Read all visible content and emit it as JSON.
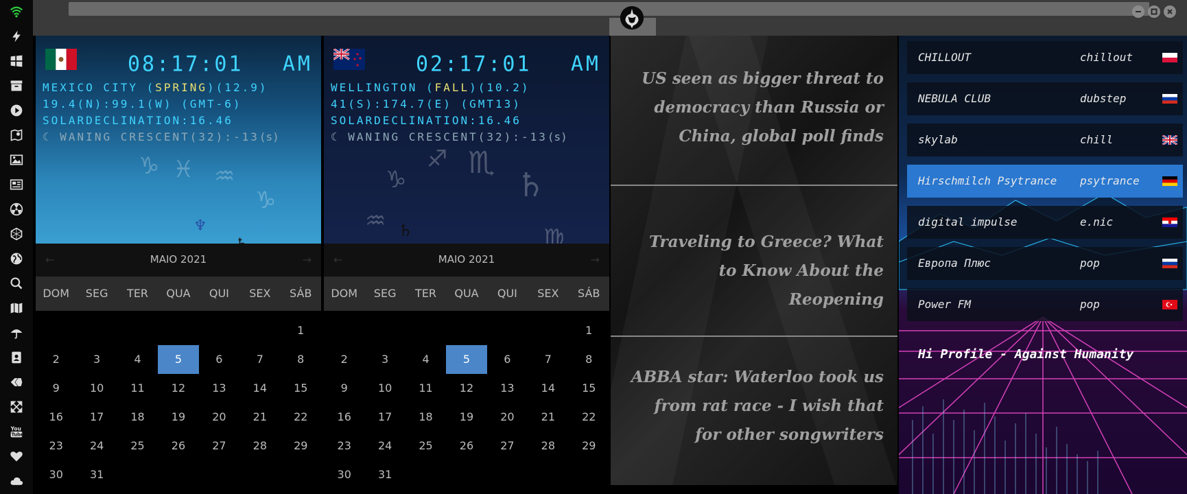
{
  "sidebar": {
    "icons": [
      "wifi-icon",
      "lightning-icon",
      "windows-icon",
      "archive-icon",
      "play-icon",
      "map-book-icon",
      "image-icon",
      "news-icon",
      "radiation-icon",
      "hexagon-icon",
      "globe-icon",
      "search-icon",
      "map-icon",
      "umbrella-icon",
      "contacts-icon",
      "tag-icon",
      "expand-icon",
      "youtube-icon",
      "heart-icon",
      "cloud-icon"
    ]
  },
  "clocks": [
    {
      "time": "08:17:01",
      "ampm": "AM",
      "city": "MEXICO CITY",
      "season": "SPRING",
      "temp": "(12.9)",
      "coords": "19.4(N):99.1(W) (GMT-6)",
      "declination": "SOLARDECLINATION:16.46",
      "moon": "WANING CRESCENT(32):-13",
      "moon_unit": "(s)"
    },
    {
      "time": "02:17:01",
      "ampm": "AM",
      "city": "WELLINGTON",
      "season": "FALL",
      "temp": "(10.2)",
      "coords": "41(S):174.7(E) (GMT13)",
      "declination": "SOLARDECLINATION:16.46",
      "moon": "WANING CRESCENT(32):-13",
      "moon_unit": "(s)"
    }
  ],
  "calendar": {
    "title": "MAIO 2021",
    "prev": "←",
    "next": "→",
    "weekdays": [
      "DOM",
      "SEG",
      "TER",
      "QUA",
      "QUI",
      "SEX",
      "SÁB"
    ],
    "selected": "5",
    "weeks": [
      [
        "",
        "",
        "",
        "",
        "",
        "",
        "1"
      ],
      [
        "2",
        "3",
        "4",
        "5",
        "6",
        "7",
        "8"
      ],
      [
        "9",
        "10",
        "11",
        "12",
        "13",
        "14",
        "15"
      ],
      [
        "16",
        "17",
        "18",
        "19",
        "20",
        "21",
        "22"
      ],
      [
        "23",
        "24",
        "25",
        "26",
        "27",
        "28",
        "29"
      ],
      [
        "30",
        "31",
        "",
        "",
        "",
        "",
        ""
      ]
    ]
  },
  "news": [
    "US seen as bigger threat to democracy than Russia or China, global poll finds",
    "Traveling to Greece? What to Know About the Reopening",
    "ABBA star: Waterloo took us from rat race - I wish that for other songwriters"
  ],
  "radio": {
    "stations": [
      {
        "name": "CHILLOUT",
        "genre": "chillout",
        "flag": "poland"
      },
      {
        "name": "NEBULA CLUB",
        "genre": "dubstep",
        "flag": "russia"
      },
      {
        "name": "skylab",
        "genre": "chill",
        "flag": "uk"
      },
      {
        "name": "Hirschmilch Psytrance",
        "genre": "psytrance",
        "flag": "germany"
      },
      {
        "name": "digital impulse",
        "genre": "e.nic",
        "flag": "croatia"
      },
      {
        "name": "Европа Плюс",
        "genre": "pop",
        "flag": "russia"
      },
      {
        "name": "Power FM",
        "genre": "pop",
        "flag": "turkey"
      }
    ],
    "active_index": 3,
    "now_playing": "Hi Profile - Against Humanity"
  },
  "colors": {
    "clock_text": "#3fd4ff",
    "calendar_selected": "#4a86c8",
    "station_active": "#2a78d0"
  }
}
